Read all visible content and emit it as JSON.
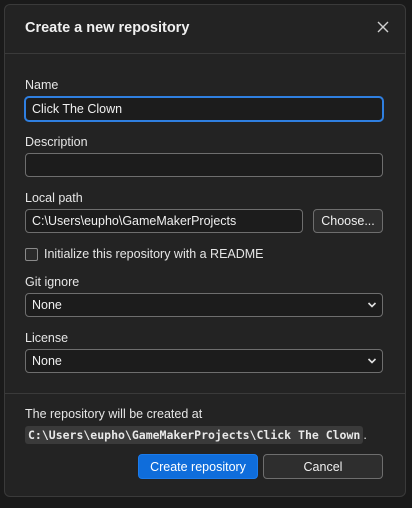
{
  "dialog": {
    "title": "Create a new repository",
    "close_icon": "close-icon"
  },
  "form": {
    "name": {
      "label": "Name",
      "value": "Click The Clown"
    },
    "description": {
      "label": "Description",
      "value": ""
    },
    "local_path": {
      "label": "Local path",
      "value": "C:\\Users\\eupho\\GameMakerProjects",
      "choose_label": "Choose..."
    },
    "readme": {
      "label": "Initialize this repository with a README",
      "checked": false
    },
    "git_ignore": {
      "label": "Git ignore",
      "selected": "None"
    },
    "license": {
      "label": "License",
      "selected": "None"
    }
  },
  "footer": {
    "text_before": "The repository will be created at ",
    "path": "C:\\Users\\eupho\\GameMakerProjects\\Click The Clown",
    "text_after": ".",
    "create_label": "Create repository",
    "cancel_label": "Cancel"
  },
  "colors": {
    "accent": "#0f6ddb",
    "background": "#232323",
    "focus": "#2f7fe0"
  }
}
